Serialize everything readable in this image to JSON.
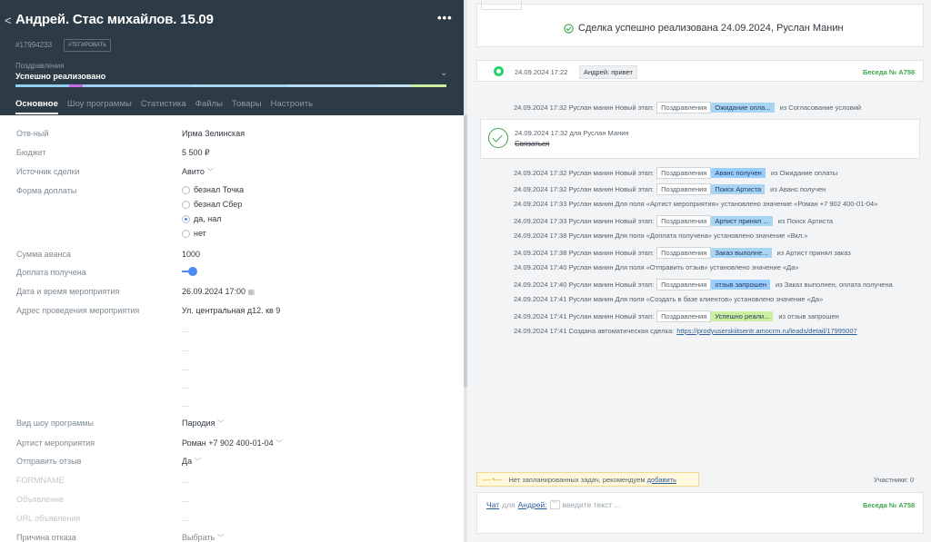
{
  "deal": {
    "back": "<",
    "title": "Андрей. Стас михайлов. 15.09",
    "menu": "•••",
    "id": "#17994233",
    "tag_button": "#ТЕГИРОВАТЬ",
    "pipeline": "Поздравления",
    "stage": "Успешно реализовано",
    "stage_chevron": "⌄",
    "stage_colors": [
      "#8fd0f0",
      "#c86ee0",
      "#9ecff2",
      "#a9d5f5",
      "#b6daf3",
      "#c2e0f5",
      "#ccf0a0"
    ]
  },
  "tabs": [
    {
      "label": "Основное"
    },
    {
      "label": "Шоу программы"
    },
    {
      "label": "Статистика"
    },
    {
      "label": "Файлы"
    },
    {
      "label": "Товары"
    },
    {
      "label": "Настроить"
    }
  ],
  "fields": {
    "responsible": {
      "label": "Отв-ный",
      "value": "Ирма Зелинская"
    },
    "budget": {
      "label": "Бюджет",
      "value": "5 500 ₽"
    },
    "source": {
      "label": "Источник сделки",
      "value": "Авито"
    },
    "payment_form": {
      "label": "Форма доплаты",
      "options": [
        "безнал Точка",
        "безнал Сбер",
        "да, нал",
        "нет"
      ],
      "selected": "да, нал"
    },
    "advance": {
      "label": "Сумма аванса",
      "value": "1000"
    },
    "paid": {
      "label": "Доплата получена",
      "value": true
    },
    "event_date": {
      "label": "Дата и время мероприятия",
      "value": "26.09.2024 17:00"
    },
    "address": {
      "label": "Адрес проведения мероприятия",
      "value": "Ул. центральная д12. кв 9",
      "extra": [
        "...",
        "...",
        "...",
        "...",
        "..."
      ]
    },
    "show_type": {
      "label": "Вид шоу программы",
      "value": "Пародия"
    },
    "artist": {
      "label": "Артист мероприятия",
      "value": "Роман +7 902 400-01-04"
    },
    "send_review": {
      "label": "Отправить отзыв",
      "value": "Да"
    },
    "formname": {
      "label": "FORMNAME",
      "value": "..."
    },
    "ad": {
      "label": "Объявление",
      "value": "..."
    },
    "ad_url": {
      "label": "URL объявления",
      "value": "..."
    },
    "refusal": {
      "label": "Причина отказа",
      "value": "Выбрать"
    }
  },
  "feed": {
    "success": "Сделка успешно реализована 24.09.2024, Руслан Манин",
    "message": {
      "time": "24.09.2024 17:22",
      "text": "Андрей: привет",
      "chat": "Беседа № А758"
    },
    "events": [
      {
        "text": "24.09.2024 17:32 Руслан манин Новый этап:",
        "pipe": "Поздравления",
        "stage": "Ожидание опла...",
        "stage_color": "#a9d5f5",
        "from": "из Согласование условий"
      },
      {
        "text": "24.09.2024 17:32 Руслан манин Новый этап:",
        "pipe": "Поздравления",
        "stage": "Аванс получен",
        "stage_color": "#99ccff",
        "from": "из Ожидание оплаты"
      },
      {
        "text": "24.09.2024 17:32 Руслан манин Новый этап:",
        "pipe": "Поздравления",
        "stage": "Поиск Артиста",
        "stage_color": "#a9d5f5",
        "from": "из Аванс получен"
      },
      {
        "text": "24.09.2024 17:33 Руслан манин Для поля «Артист мероприятия» установлено значение «Роман +7 902 400-01-04»"
      },
      {
        "text": "24.09.2024 17:33 Руслан манин Новый этап:",
        "pipe": "Поздравления",
        "stage": "Артист принял ...",
        "stage_color": "#a9d5f5",
        "from": "из Поиск Артиста"
      },
      {
        "text": "24.09.2024 17:38 Руслан манин Для поля «Доплата получена» установлено значение «Вкл.»"
      },
      {
        "text": "24.09.2024 17:38 Руслан манин Новый этап:",
        "pipe": "Поздравления",
        "stage": "Заказ выполне...",
        "stage_color": "#a9d5f5",
        "from": "из Артист принял заказ"
      },
      {
        "text": "24.09.2024 17:40 Руслан манин Для поля «Отправить отзыв» установлено значение «Да»"
      },
      {
        "text": "24.09.2024 17:40 Руслан манин Новый этап:",
        "pipe": "Поздравления",
        "stage": "отзыв запрошен",
        "stage_color": "#99ccff",
        "from": "из Заказ выполнен, оплата получена"
      },
      {
        "text": "24.09.2024 17:41 Руслан манин Для поля «Создать в базе клиентов» установлено значение «Да»"
      },
      {
        "text": "24.09.2024 17:41 Руслан манин Новый этап:",
        "pipe": "Поздравления",
        "stage": "Успешно реали...",
        "stage_color": "#ccf0a0",
        "from": "из отзыв запрошен"
      },
      {
        "text": "24.09.2024 17:41 Создана автоматическая сделка:",
        "link": "https://prodyuserskiitsentr.amocrm.ru/leads/detail/17995007"
      }
    ],
    "task": {
      "time": "24.09.2024 17:32  для Руслан Манин",
      "text": "Связаться"
    }
  },
  "bottom": {
    "no_tasks": "Нет запланированных задач, рекомендуем",
    "add": "добавить",
    "participants": "Участники: 0",
    "chat_word": "Чат",
    "for_word": "для",
    "recipient": "Андрей:",
    "placeholder": "введите текст ...",
    "chat_id": "Беседа № А758"
  }
}
